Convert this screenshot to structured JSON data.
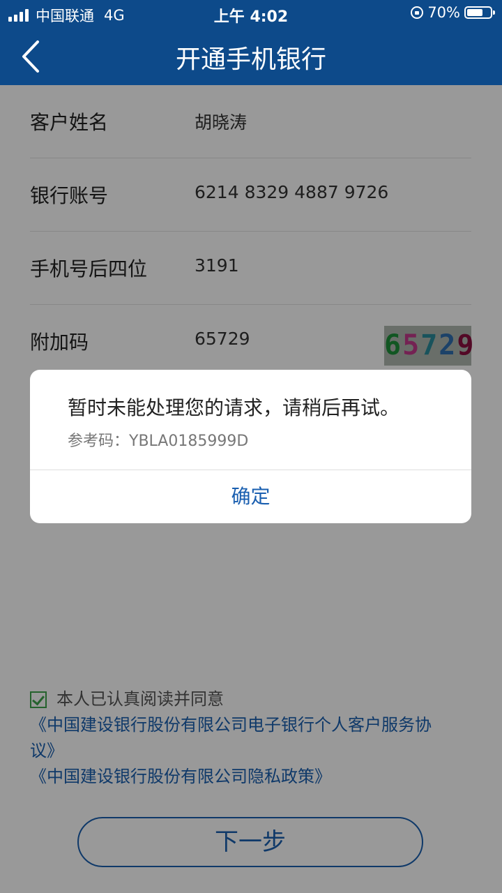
{
  "status_bar": {
    "carrier": "中国联通",
    "network": "4G",
    "time": "上午 4:02",
    "battery_percent": "70%",
    "battery_level": 0.7
  },
  "header": {
    "title": "开通手机银行"
  },
  "form": {
    "rows": [
      {
        "label": "客户姓名",
        "value": "胡晓涛"
      },
      {
        "label": "银行账号",
        "value": "6214 8329 4887 9726"
      },
      {
        "label": "手机号后四位",
        "value": "3191"
      },
      {
        "label": "附加码",
        "value": "65729"
      }
    ],
    "captcha_digits": [
      "6",
      "5",
      "7",
      "2",
      "9"
    ]
  },
  "agreement": {
    "checked": true,
    "text": "本人已认真阅读并同意",
    "link1_line1": "《中国建设银行股份有限公司电子银行个人客户服务协",
    "link1_line2": "议》",
    "link2": "《中国建设银行股份有限公司隐私政策》"
  },
  "next_button": {
    "label": "下一步"
  },
  "dialog": {
    "message": "暂时未能处理您的请求，请稍后再试。",
    "reference": "参考码：YBLA0185999D",
    "ok_label": "确定"
  }
}
